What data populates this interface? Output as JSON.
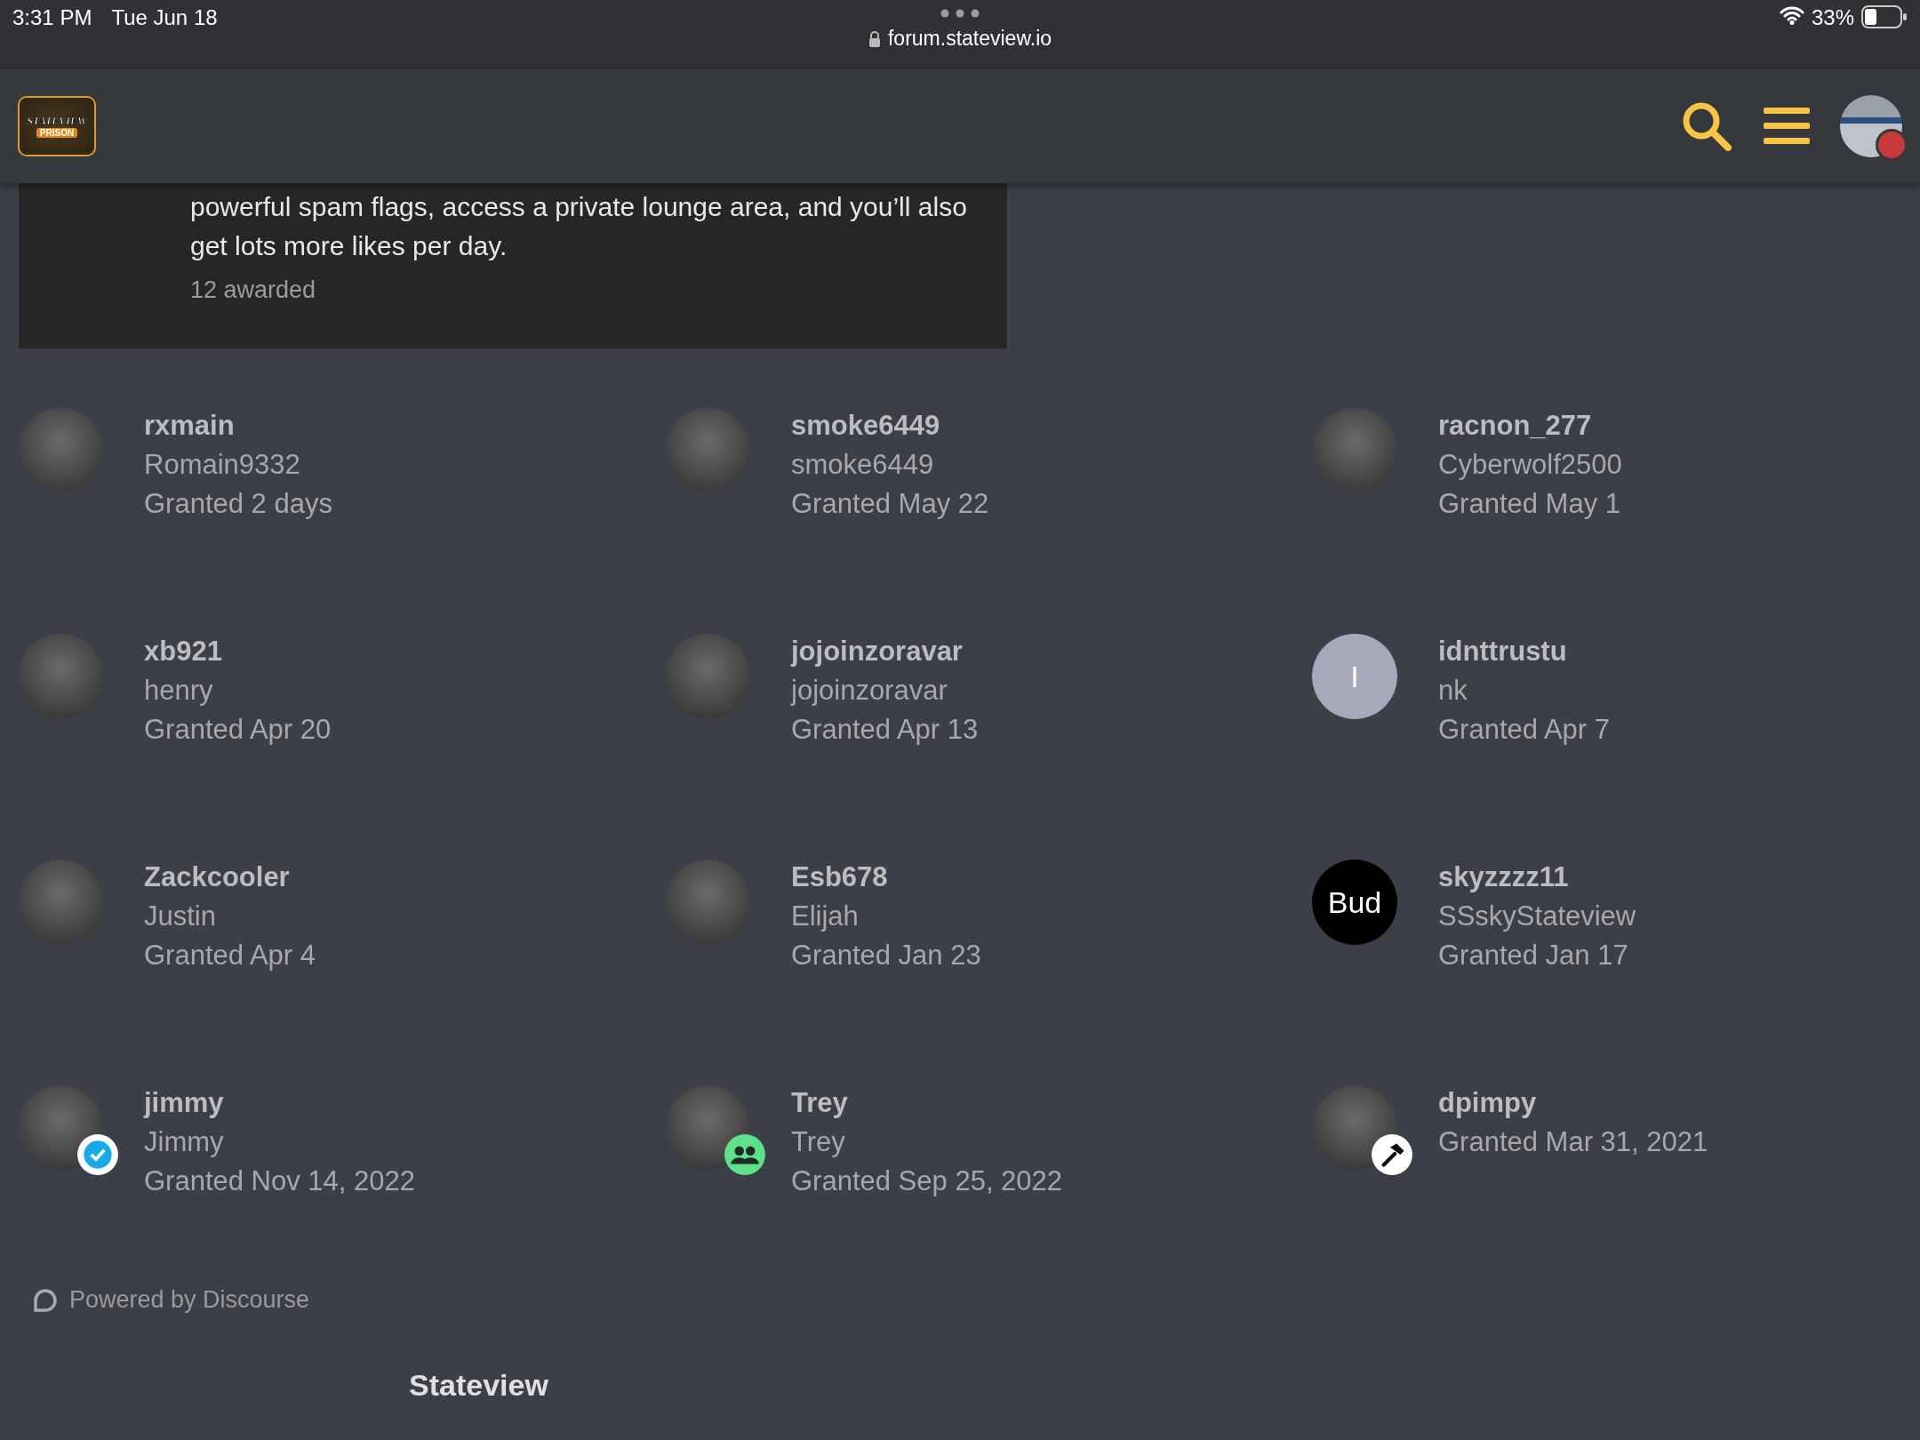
{
  "status_bar": {
    "time": "3:31 PM",
    "date": "Tue Jun 18",
    "battery": "33%",
    "url": "forum.stateview.io"
  },
  "header": {
    "logo_text": "STATEVIEW",
    "logo_sub": "PRISON"
  },
  "badge_card": {
    "description": "powerful spam flags, access a private lounge area, and you’ll also get lots more likes per day.",
    "awarded": "12 awarded"
  },
  "users": [
    {
      "name": "rxmain",
      "username": "Romain9332",
      "granted": "Granted 2 days",
      "avatar": {
        "kind": "photo"
      }
    },
    {
      "name": "smoke6449",
      "username": "smoke6449",
      "granted": "Granted May 22",
      "avatar": {
        "kind": "photo"
      }
    },
    {
      "name": "racnon_277",
      "username": "Cyberwolf2500",
      "granted": "Granted May 1",
      "avatar": {
        "kind": "photo"
      }
    },
    {
      "name": "xb921",
      "username": "henry",
      "granted": "Granted Apr 20",
      "avatar": {
        "kind": "photo"
      }
    },
    {
      "name": "jojoinzoravar",
      "username": "jojoinzoravar",
      "granted": "Granted Apr 13",
      "avatar": {
        "kind": "photo"
      }
    },
    {
      "name": "idnttrustu",
      "username": "nk",
      "granted": "Granted Apr 7",
      "avatar": {
        "kind": "letter",
        "letter": "I",
        "color": "#a6a9bc"
      }
    },
    {
      "name": "Zackcooler",
      "username": "Justin",
      "granted": "Granted Apr 4",
      "avatar": {
        "kind": "photo"
      }
    },
    {
      "name": "Esb678",
      "username": "Elijah",
      "granted": "Granted Jan 23",
      "avatar": {
        "kind": "photo"
      }
    },
    {
      "name": "skyzzzz11",
      "username": "SSskyStateview",
      "granted": "Granted Jan 17",
      "avatar": {
        "kind": "letter",
        "letter": "Bud",
        "color": "#000000"
      }
    },
    {
      "name": "jimmy",
      "username": "Jimmy",
      "granted": "Granted Nov 14, 2022",
      "avatar": {
        "kind": "photo",
        "badge": {
          "kind": "check"
        }
      }
    },
    {
      "name": "Trey",
      "username": "Trey",
      "granted": "Granted Sep 25, 2022",
      "avatar": {
        "kind": "photo",
        "badge": {
          "kind": "group"
        }
      }
    },
    {
      "name": "dpimpy",
      "granted": "Granted Mar 31, 2021",
      "avatar": {
        "kind": "photo",
        "badge": {
          "kind": "hammer"
        }
      }
    }
  ],
  "footer": {
    "powered_by": "Powered by Discourse",
    "heading": "Stateview"
  }
}
